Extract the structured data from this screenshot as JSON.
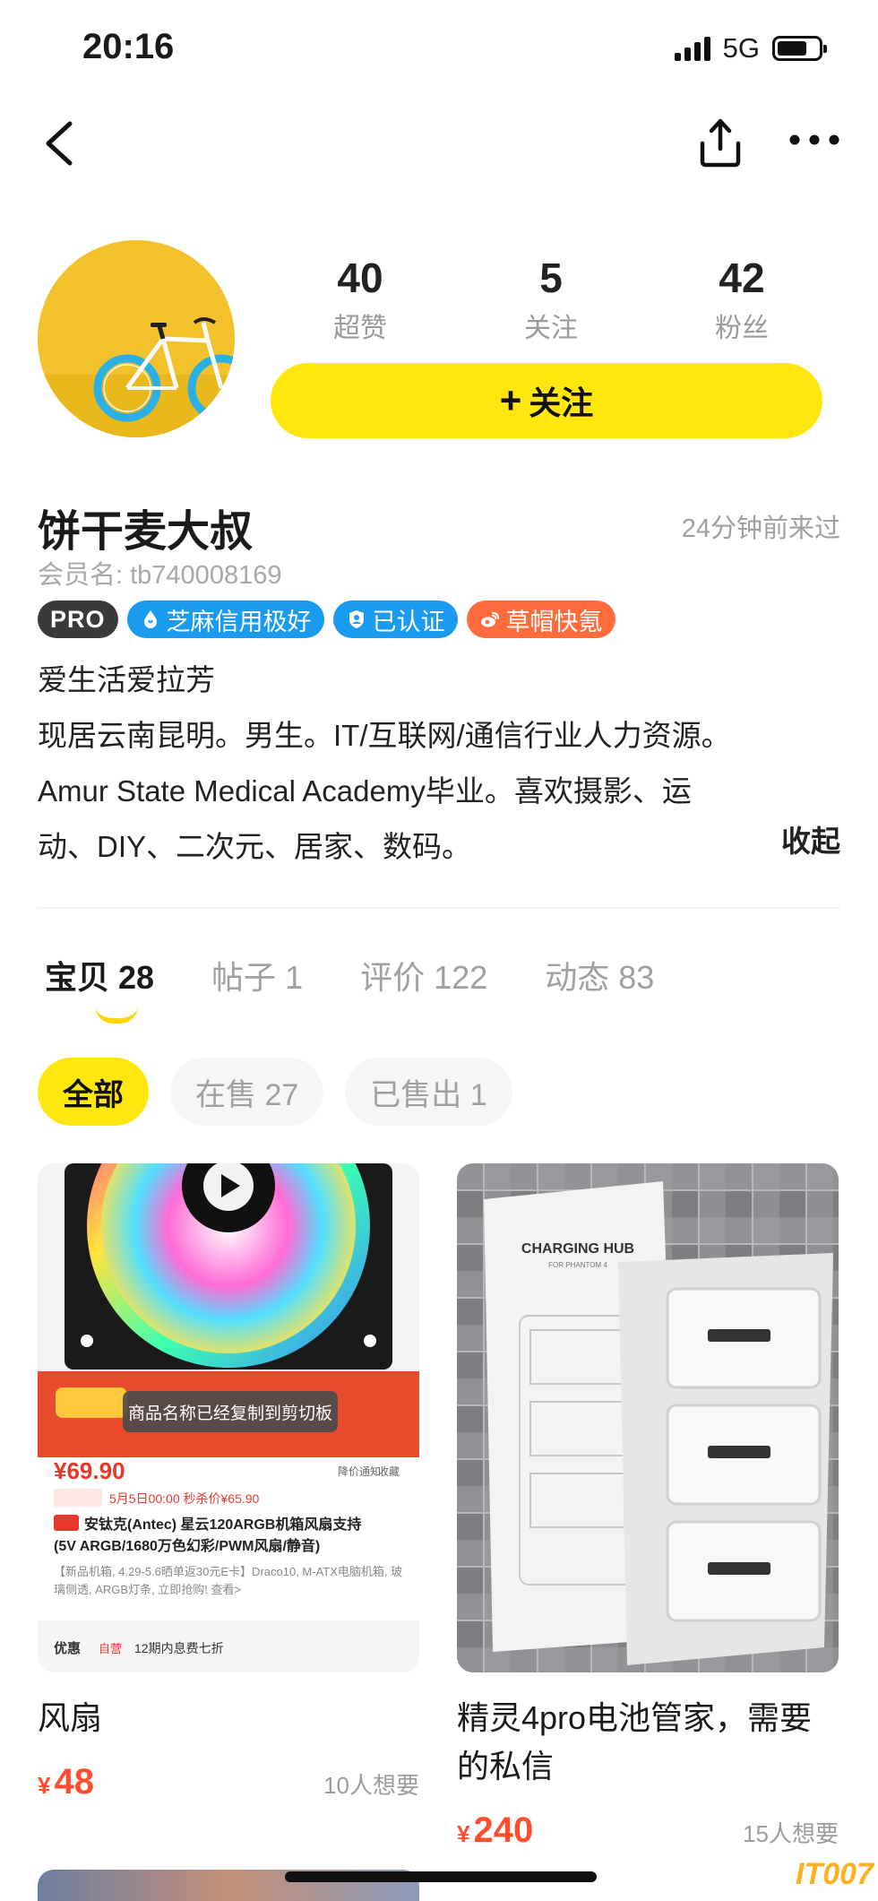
{
  "status_bar": {
    "time": "20:16",
    "network": "5G"
  },
  "profile": {
    "stats": [
      {
        "value": "40",
        "label": "超赞"
      },
      {
        "value": "5",
        "label": "关注"
      },
      {
        "value": "42",
        "label": "粉丝"
      }
    ],
    "follow_label": "关注",
    "follow_plus": "+",
    "nickname": "饼干麦大叔",
    "last_seen": "24分钟前来过",
    "member_id": "会员名: tb740008169",
    "badges": {
      "pro": "PRO",
      "credit": "芝麻信用极好",
      "verified": "已认证",
      "weibo": "草帽快氪"
    },
    "bio_lines": [
      "爱生活爱拉芳",
      "现居云南昆明。男生。IT/互联网/通信行业人力资源。",
      "Amur State Medical Academy毕业。喜欢摄影、运",
      "动、DIY、二次元、居家、数码。"
    ],
    "collapse_label": "收起"
  },
  "tabs": [
    {
      "label": "宝贝",
      "count": "28"
    },
    {
      "label": "帖子",
      "count": "1"
    },
    {
      "label": "评价",
      "count": "122"
    },
    {
      "label": "动态",
      "count": "83"
    }
  ],
  "filters": [
    "全部",
    "在售 27",
    "已售出 1"
  ],
  "items": [
    {
      "title": "风扇",
      "currency": "¥",
      "price": "48",
      "wants": "10人想要",
      "thumb_text": {
        "toast": "商品名称已经复制到剪切板",
        "price": "¥69.90",
        "presale": "5月5日00:00 秒杀价¥65.90",
        "name_line1": "安钛克(Antec) 星云120ARGB机箱风扇支持",
        "name_line2": "(5V ARGB/1680万色幻彩/PWM风扇/静音)",
        "desc": "【新品机箱, 4.29-5.6晒单返30元E卡】Draco10, M-ATX电脑机箱, 玻璃侧透, ARGB灯条, 立即抢购! 查看>",
        "promo": "优惠",
        "promo_tag": "自营",
        "promo_text": "12期内息费七折",
        "notify": "降价通知",
        "fav": "收藏"
      }
    },
    {
      "title": "精灵4pro电池管家，需要的私信",
      "currency": "¥",
      "price": "240",
      "wants": "15人想要",
      "thumb_text": {
        "hub_title": "CHARGING HUB",
        "hub_sub": "FOR PHANTOM 4"
      }
    }
  ],
  "watermark": "IT007",
  "colors": {
    "accent_yellow": "#ffe60f",
    "price_red": "#ff4d2d",
    "badge_blue": "#1a9bf0",
    "badge_orange": "#ff6b3d"
  }
}
